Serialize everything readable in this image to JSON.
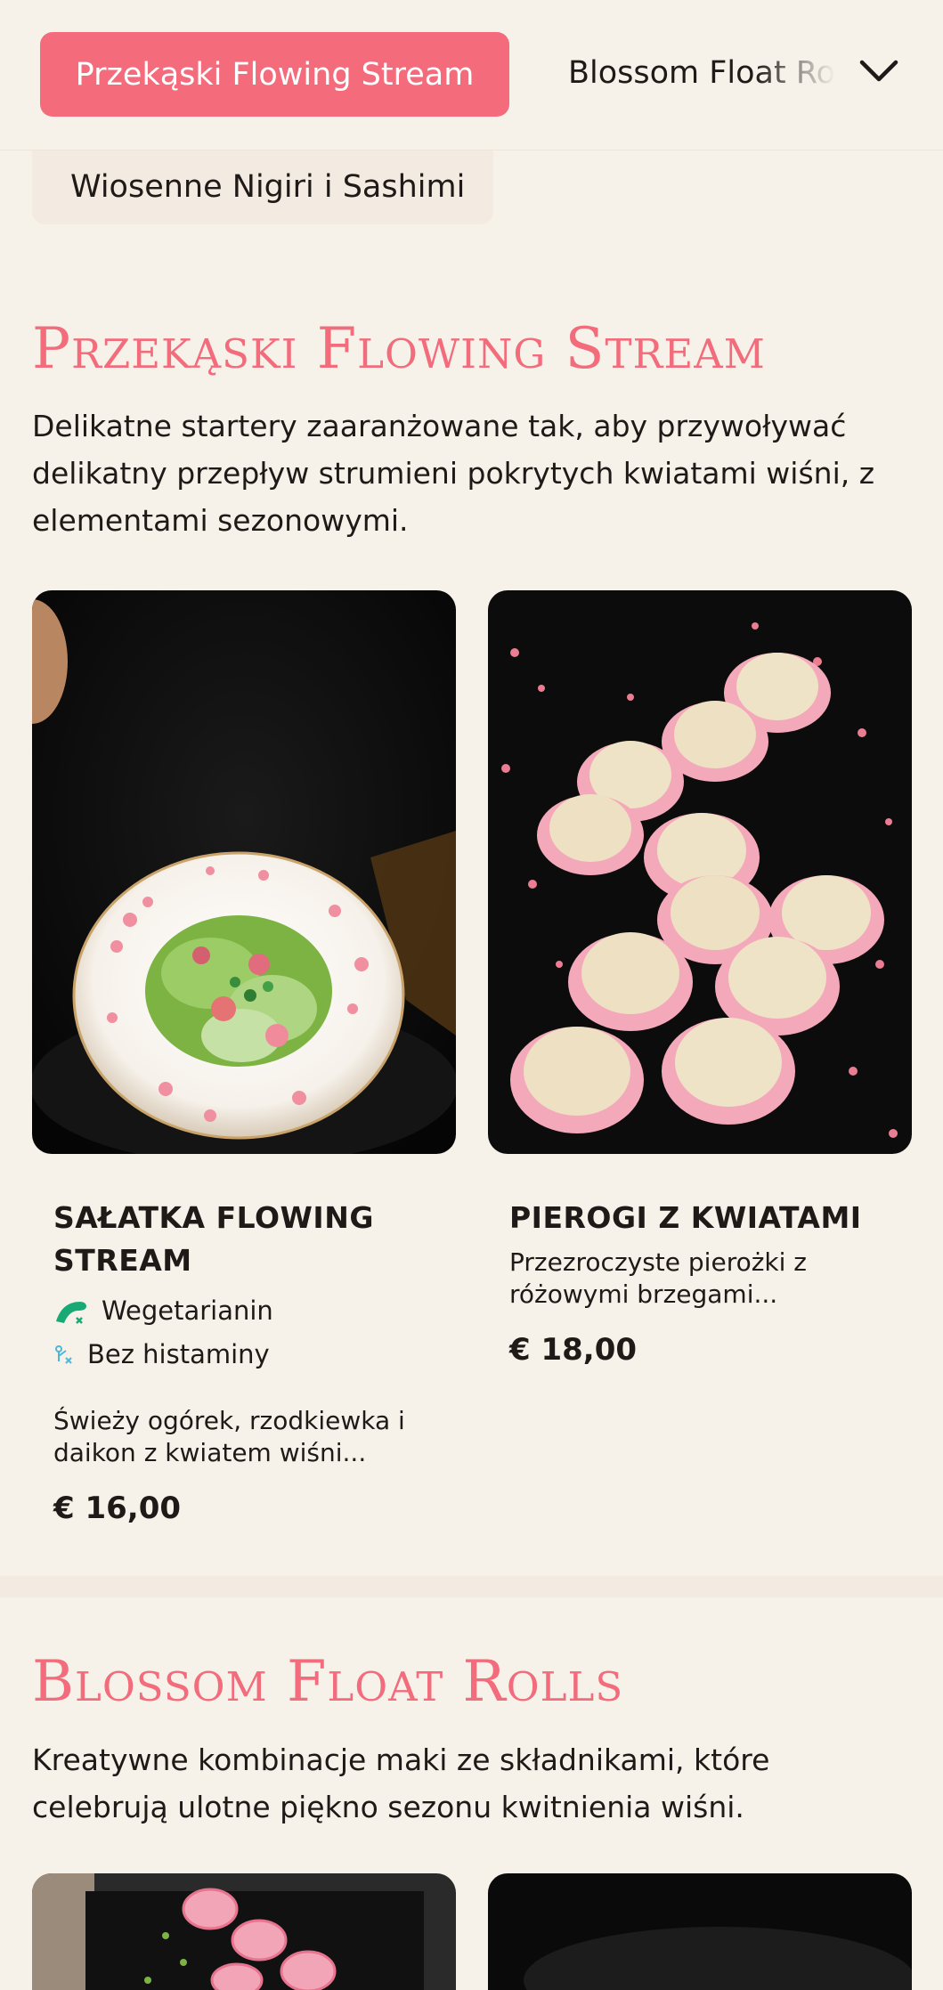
{
  "nav": {
    "active_tab": "Przekąski Flowing Stream",
    "next_tab": "Blossom Float Rolls",
    "subcategory_chip": "Wiosenne Nigiri i Sashimi"
  },
  "section1": {
    "title": "Przekąski Flowing Stream",
    "description": "Delikatne startery zaaranżowane tak, aby przywoływać delikatny przepływ strumieni pokrytych kwiatami wiśni, z elementami sezonowymi.",
    "items": [
      {
        "name": "SAŁATKA FLOWING STREAM",
        "tags": [
          "Wegetarianin",
          "Bez histaminy"
        ],
        "description": "Świeży ogórek, rzodkiewka i daikon z kwiatem wiśni...",
        "price": "€ 16,00"
      },
      {
        "name": "PIEROGI Z KWIATAMI",
        "tags": [],
        "description": "Przezroczyste pierożki z różowymi brzegami...",
        "price": "€ 18,00"
      }
    ]
  },
  "section2": {
    "title": "Blossom Float Rolls",
    "description": "Kreatywne kombinacje maki ze składnikami, które celebrują ulotne piękno sezonu kwitnienia wiśni."
  },
  "colors": {
    "accent": "#f46b7c",
    "background": "#f6f2ea",
    "veg_icon": "#19a974",
    "histamine_icon": "#4fb6d8"
  }
}
